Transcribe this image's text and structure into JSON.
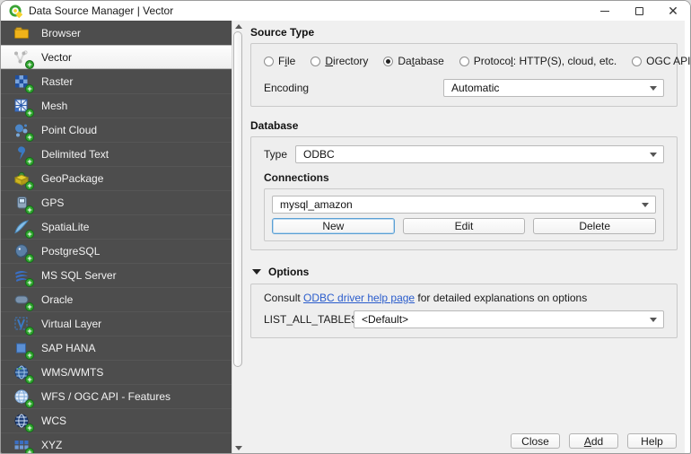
{
  "window": {
    "title": "Data Source Manager | Vector"
  },
  "colors": {
    "accent_focus": "#5a9fd4",
    "link": "#2a5ccc",
    "sidebar_bg": "#4d4d4d",
    "selected_item_bg": "#f5f5f5",
    "plus_badge": "#2ea52c",
    "folder_yellow": "#efb21a"
  },
  "sidebar": {
    "items": [
      {
        "label": "Browser",
        "icon": "browser-folder-icon",
        "selected": false,
        "plus": false
      },
      {
        "label": "Vector",
        "icon": "vector-icon",
        "selected": true,
        "plus": true
      },
      {
        "label": "Raster",
        "icon": "raster-icon",
        "selected": false,
        "plus": true
      },
      {
        "label": "Mesh",
        "icon": "mesh-icon",
        "selected": false,
        "plus": true
      },
      {
        "label": "Point Cloud",
        "icon": "point-cloud-icon",
        "selected": false,
        "plus": true
      },
      {
        "label": "Delimited Text",
        "icon": "delimited-text-icon",
        "selected": false,
        "plus": true
      },
      {
        "label": "GeoPackage",
        "icon": "geopackage-icon",
        "selected": false,
        "plus": true
      },
      {
        "label": "GPS",
        "icon": "gps-icon",
        "selected": false,
        "plus": true
      },
      {
        "label": "SpatiaLite",
        "icon": "spatialite-icon",
        "selected": false,
        "plus": true
      },
      {
        "label": "PostgreSQL",
        "icon": "postgresql-icon",
        "selected": false,
        "plus": true
      },
      {
        "label": "MS SQL Server",
        "icon": "mssql-icon",
        "selected": false,
        "plus": true
      },
      {
        "label": "Oracle",
        "icon": "oracle-icon",
        "selected": false,
        "plus": true
      },
      {
        "label": "Virtual Layer",
        "icon": "virtual-layer-icon",
        "selected": false,
        "plus": true
      },
      {
        "label": "SAP HANA",
        "icon": "sap-hana-icon",
        "selected": false,
        "plus": true
      },
      {
        "label": "WMS/WMTS",
        "icon": "wms-icon",
        "selected": false,
        "plus": true
      },
      {
        "label": "WFS / OGC API - Features",
        "icon": "wfs-icon",
        "selected": false,
        "plus": true
      },
      {
        "label": "WCS",
        "icon": "wcs-icon",
        "selected": false,
        "plus": true
      },
      {
        "label": "XYZ",
        "icon": "xyz-icon",
        "selected": false,
        "plus": true
      }
    ]
  },
  "source_type": {
    "heading": "Source Type",
    "radios": [
      {
        "pre": "F",
        "accel": "i",
        "post": "le",
        "selected": false
      },
      {
        "pre": "",
        "accel": "D",
        "post": "irectory",
        "selected": false
      },
      {
        "pre": "Da",
        "accel": "t",
        "post": "abase",
        "selected": true
      },
      {
        "pre": "Protoco",
        "accel": "l",
        "post": ": HTTP(S), cloud, etc.",
        "selected": false
      },
      {
        "pre": "OGC API",
        "accel": "",
        "post": "",
        "selected": false
      }
    ],
    "encoding_label": "Encoding",
    "encoding_value": "Automatic"
  },
  "database": {
    "heading": "Database",
    "type_label": "Type",
    "type_value": "ODBC",
    "connections_heading": "Connections",
    "connection_value": "mysql_amazon",
    "buttons": [
      {
        "label": "New",
        "focused": true
      },
      {
        "label": "Edit",
        "focused": false
      },
      {
        "label": "Delete",
        "focused": false
      }
    ]
  },
  "options": {
    "heading": "Options",
    "consult_pre": "Consult ",
    "consult_link": "ODBC driver help page",
    "consult_post": " for detailed explanations on options",
    "list_all_tables_label": "LIST_ALL_TABLES",
    "list_all_tables_value": "<Default>"
  },
  "footer": {
    "buttons": [
      {
        "pre": "Close",
        "accel": "",
        "post": ""
      },
      {
        "pre": "",
        "accel": "A",
        "post": "dd"
      },
      {
        "pre": "Help",
        "accel": "",
        "post": ""
      }
    ]
  }
}
